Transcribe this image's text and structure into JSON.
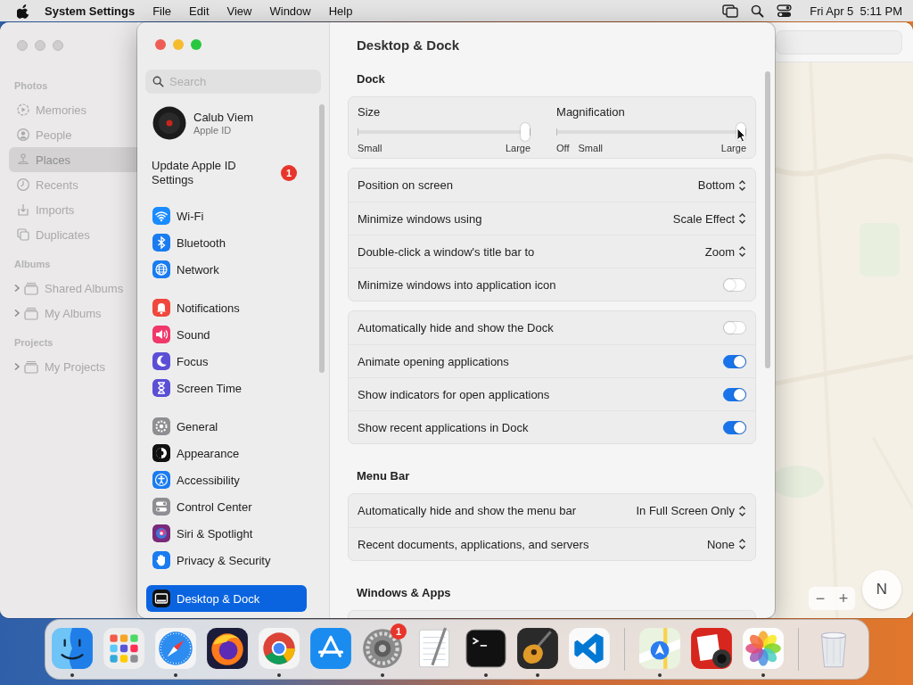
{
  "menubar": {
    "app": "System Settings",
    "menus": [
      "File",
      "Edit",
      "View",
      "Window",
      "Help"
    ],
    "clock": "Fri Apr 5  5:11 PM"
  },
  "photos_window": {
    "sidebar": [
      {
        "title": "Photos",
        "items": [
          {
            "label": "Memories",
            "selected": false
          },
          {
            "label": "People",
            "selected": false
          },
          {
            "label": "Places",
            "selected": true
          },
          {
            "label": "Recents",
            "selected": false
          },
          {
            "label": "Imports",
            "selected": false
          },
          {
            "label": "Duplicates",
            "selected": false
          }
        ]
      },
      {
        "title": "Albums",
        "items": [
          {
            "label": "Shared Albums",
            "selected": false,
            "expanded": false
          },
          {
            "label": "My Albums",
            "selected": false,
            "expanded": false
          }
        ]
      },
      {
        "title": "Projects",
        "items": [
          {
            "label": "My Projects",
            "selected": false,
            "expanded": false
          }
        ]
      }
    ],
    "map": {
      "zoom_out": "−",
      "zoom_in": "+",
      "compass": "N"
    }
  },
  "settings": {
    "title": "Desktop & Dock",
    "search": {
      "placeholder": "Search"
    },
    "account": {
      "name": "Calub Viem",
      "subtitle": "Apple ID"
    },
    "alert": {
      "label": "Update Apple ID Settings",
      "badge": "1"
    },
    "sidebar": [
      [
        {
          "label": "Wi-Fi",
          "selected": false
        },
        {
          "label": "Bluetooth",
          "selected": false
        },
        {
          "label": "Network",
          "selected": false
        }
      ],
      [
        {
          "label": "Notifications",
          "selected": false
        },
        {
          "label": "Sound",
          "selected": false
        },
        {
          "label": "Focus",
          "selected": false
        },
        {
          "label": "Screen Time",
          "selected": false
        }
      ],
      [
        {
          "label": "General",
          "selected": false
        },
        {
          "label": "Appearance",
          "selected": false
        },
        {
          "label": "Accessibility",
          "selected": false
        },
        {
          "label": "Control Center",
          "selected": false
        },
        {
          "label": "Siri & Spotlight",
          "selected": false
        },
        {
          "label": "Privacy & Security",
          "selected": false
        }
      ],
      [
        {
          "label": "Desktop & Dock",
          "selected": true
        }
      ]
    ],
    "sections": [
      {
        "title": "Dock",
        "sliders": [
          {
            "label": "Size",
            "level": 0.97,
            "marks": [
              "Small",
              "Large"
            ]
          },
          {
            "label": "Magnification",
            "level": 0.97,
            "marks": [
              "Off",
              "Small",
              "Large"
            ]
          }
        ],
        "groups": [
          [
            {
              "kind": "popup",
              "label": "Position on screen",
              "value": "Bottom"
            },
            {
              "kind": "popup",
              "label": "Minimize windows using",
              "value": "Scale Effect"
            },
            {
              "kind": "popup",
              "label": "Double-click a window's title bar to",
              "value": "Zoom"
            },
            {
              "kind": "toggle",
              "label": "Minimize windows into application icon",
              "on": false
            }
          ],
          [
            {
              "kind": "toggle",
              "label": "Automatically hide and show the Dock",
              "on": false
            },
            {
              "kind": "toggle",
              "label": "Animate opening applications",
              "on": true
            },
            {
              "kind": "toggle",
              "label": "Show indicators for open applications",
              "on": true
            },
            {
              "kind": "toggle",
              "label": "Show recent applications in Dock",
              "on": true
            }
          ]
        ]
      },
      {
        "title": "Menu Bar",
        "groups": [
          [
            {
              "kind": "popup",
              "label": "Automatically hide and show the menu bar",
              "value": "In Full Screen Only"
            },
            {
              "kind": "popup",
              "label": "Recent documents, applications, and servers",
              "value": "None"
            }
          ]
        ]
      },
      {
        "title": "Windows & Apps"
      }
    ]
  },
  "dock": {
    "groups": [
      [
        {
          "running": true
        },
        {
          "running": false
        },
        {
          "running": true
        },
        {
          "running": false
        },
        {
          "running": true
        },
        {
          "running": false
        },
        {
          "running": true,
          "badge": "1"
        },
        {
          "running": false
        },
        {
          "running": true
        },
        {
          "running": true
        },
        {
          "running": false
        }
      ],
      [
        {
          "running": true
        },
        {
          "running": false
        },
        {
          "running": true
        }
      ],
      [
        {
          "running": false
        }
      ]
    ]
  }
}
